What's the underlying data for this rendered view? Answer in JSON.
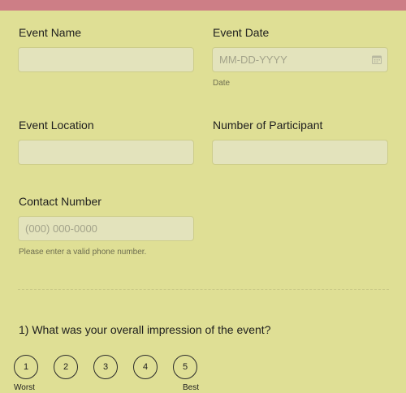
{
  "form": {
    "event_name": {
      "label": "Event Name",
      "value": "",
      "placeholder": ""
    },
    "event_date": {
      "label": "Event Date",
      "value": "",
      "placeholder": "MM-DD-YYYY",
      "sublabel": "Date",
      "icon": "calendar-icon"
    },
    "event_location": {
      "label": "Event Location",
      "value": "",
      "placeholder": ""
    },
    "participants": {
      "label": "Number of Participant",
      "value": "",
      "placeholder": ""
    },
    "contact_number": {
      "label": "Contact Number",
      "value": "",
      "placeholder": "(000) 000-0000",
      "sublabel": "Please enter a valid phone number."
    }
  },
  "rating": {
    "question": "1) What was your overall impression of the event?",
    "options": [
      "1",
      "2",
      "3",
      "4",
      "5"
    ],
    "low_label": "Worst",
    "high_label": "Best"
  },
  "colors": {
    "background": "#dfdf95",
    "header_bar": "#cd7e86",
    "input_bg": "#e3e3bc"
  }
}
